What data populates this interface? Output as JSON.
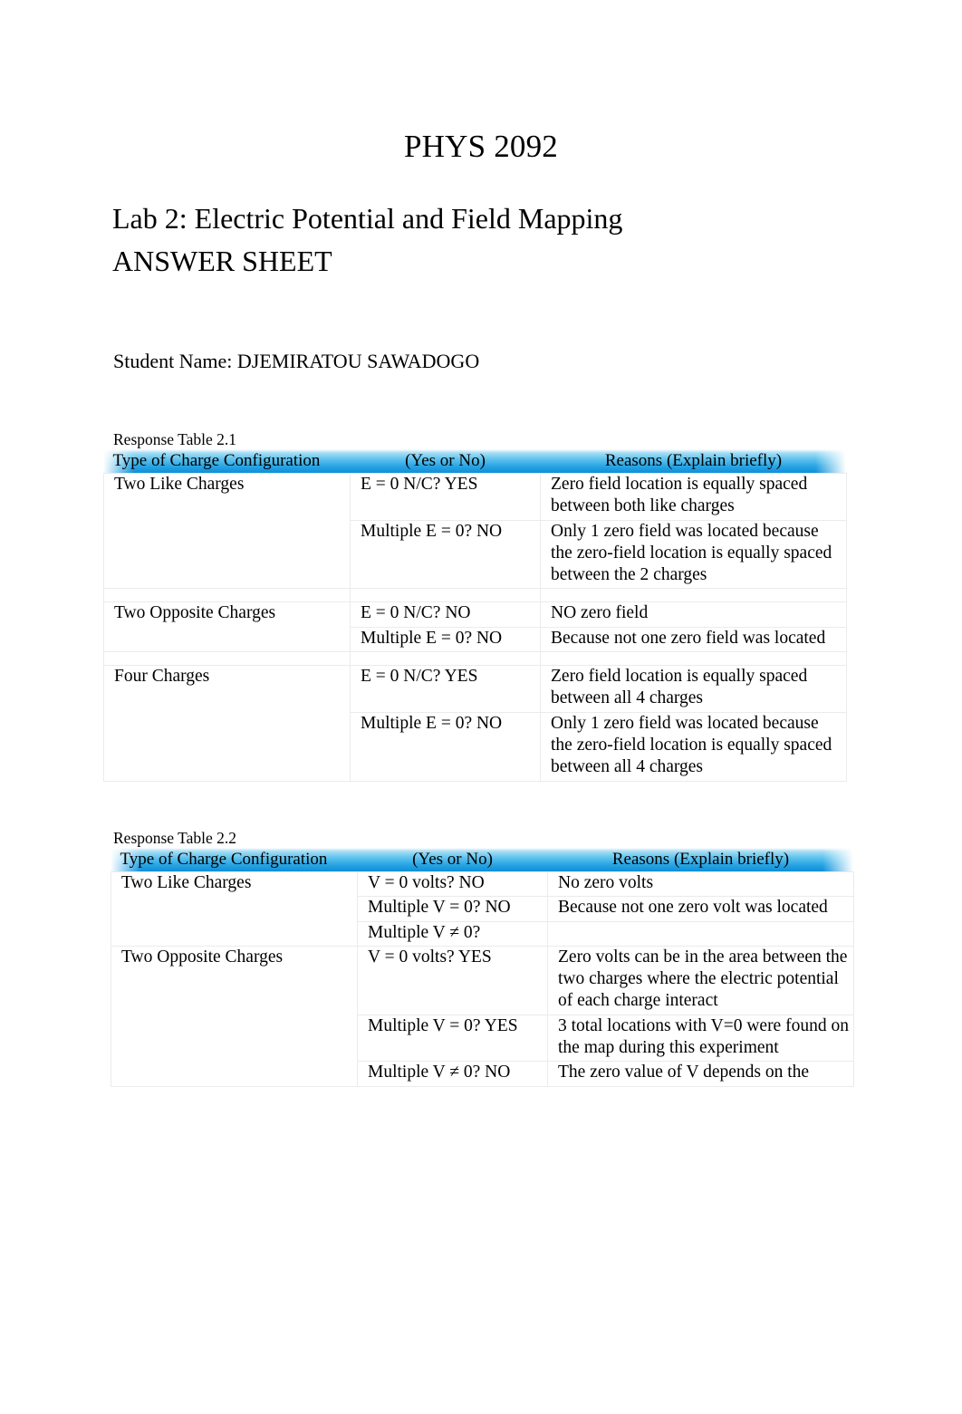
{
  "document": {
    "course_title": "PHYS 2092",
    "lab_title": "Lab 2:  Electric Potential and Field Mapping",
    "doc_type": "ANSWER SHEET",
    "student_line": "Student Name: DJEMIRATOU SAWADOGO"
  },
  "table_21": {
    "label": "Response Table 2.1",
    "headers": {
      "col1": "Type of Charge Configuration",
      "col2": "(Yes or No)",
      "col3": "Reasons (Explain briefly)"
    },
    "rows": [
      {
        "config": "Two Like Charges",
        "entries": [
          {
            "question": "E = 0 N/C? YES",
            "reason": "Zero field location is equally spaced between both like charges"
          },
          {
            "question": "Multiple E = 0? NO",
            "reason": "Only 1 zero field was located because the zero-field location is equally spaced between the 2 charges"
          }
        ]
      },
      {
        "config": "Two Opposite Charges",
        "entries": [
          {
            "question": "E = 0 N/C? NO",
            "reason": "NO zero field"
          },
          {
            "question": "Multiple E = 0? NO",
            "reason": "Because not one zero field was located"
          }
        ]
      },
      {
        "config": "Four Charges",
        "entries": [
          {
            "question": "E = 0 N/C? YES",
            "reason": "Zero field location is equally spaced between all 4 charges"
          },
          {
            "question": "Multiple E = 0? NO",
            "reason": "Only 1 zero field was located because the zero-field location is equally spaced between all 4 charges"
          }
        ]
      }
    ]
  },
  "table_22": {
    "label": "Response Table 2.2",
    "headers": {
      "col1": "Type of Charge Configuration",
      "col2": "(Yes or No)",
      "col3": "Reasons (Explain briefly)"
    },
    "rows": [
      {
        "config": "Two Like Charges",
        "entries": [
          {
            "question": "V = 0 volts? NO",
            "reason": "No zero volts"
          },
          {
            "question": "Multiple V = 0? NO",
            "reason": "Because not one zero volt was located"
          },
          {
            "question": "Multiple V ≠ 0?",
            "reason": ""
          }
        ]
      },
      {
        "config": "Two Opposite Charges",
        "entries": [
          {
            "question": "V = 0 volts? YES",
            "reason": "Zero volts can be in the area between the two charges where the electric potential of each charge interact"
          },
          {
            "question": "Multiple V = 0? YES",
            "reason": "3 total locations with V=0 were found on the map during this experiment"
          },
          {
            "question": "Multiple V ≠ 0? NO",
            "reason": "The zero value of V depends on the"
          }
        ]
      }
    ]
  },
  "theme": {
    "header_gradient_top": "#aadff5",
    "header_gradient_bottom": "#0f8ed8",
    "cell_border": "#ebebeb",
    "text_color": "#000000",
    "page_background": "#ffffff"
  }
}
